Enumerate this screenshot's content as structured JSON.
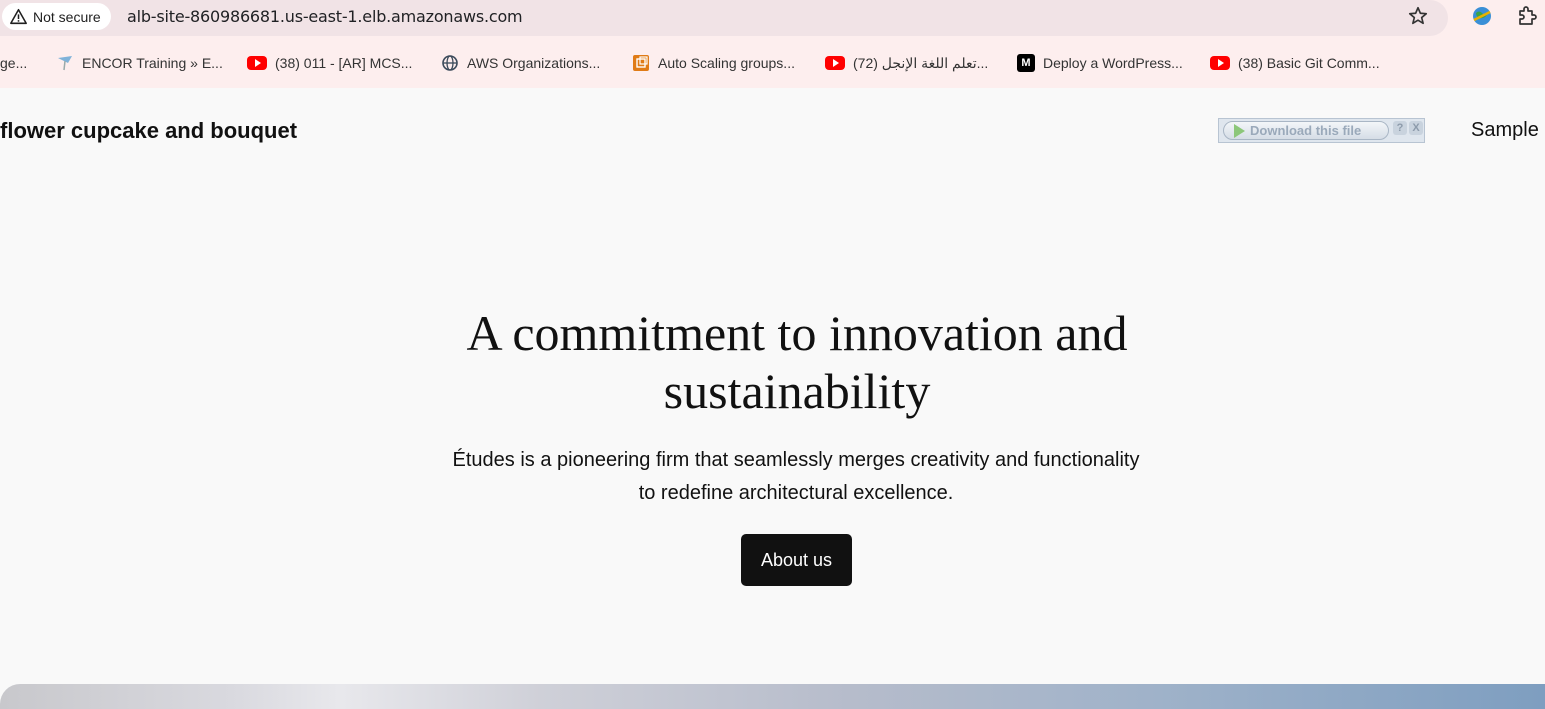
{
  "browser": {
    "security_label": "Not secure",
    "url": "alb-site-860986681.us-east-1.elb.amazonaws.com"
  },
  "bookmarks": [
    {
      "label": "ge...",
      "icon": "none"
    },
    {
      "label": "ENCOR Training » E...",
      "icon": "bookmark-pin-icon"
    },
    {
      "label": "(38) 011 - [AR] MCS...",
      "icon": "youtube-icon"
    },
    {
      "label": "AWS Organizations...",
      "icon": "globe-icon"
    },
    {
      "label": "Auto Scaling groups...",
      "icon": "aws-service-icon"
    },
    {
      "label": "(72) تعلم اللغة الإنجل...",
      "icon": "youtube-icon"
    },
    {
      "label": "Deploy a WordPress...",
      "icon": "medium-icon"
    },
    {
      "label": "(38) Basic Git Comm...",
      "icon": "youtube-icon"
    }
  ],
  "site": {
    "title": "flower cupcake and bouquet",
    "nav_item": "Sample"
  },
  "download_widget": {
    "label": "Download this file",
    "help": "?",
    "close": "X"
  },
  "hero": {
    "heading": "A commitment to innovation and sustainability",
    "text": "Études is a pioneering firm that seamlessly merges creativity and functionality to redefine architectural excellence.",
    "button_label": "About us"
  }
}
